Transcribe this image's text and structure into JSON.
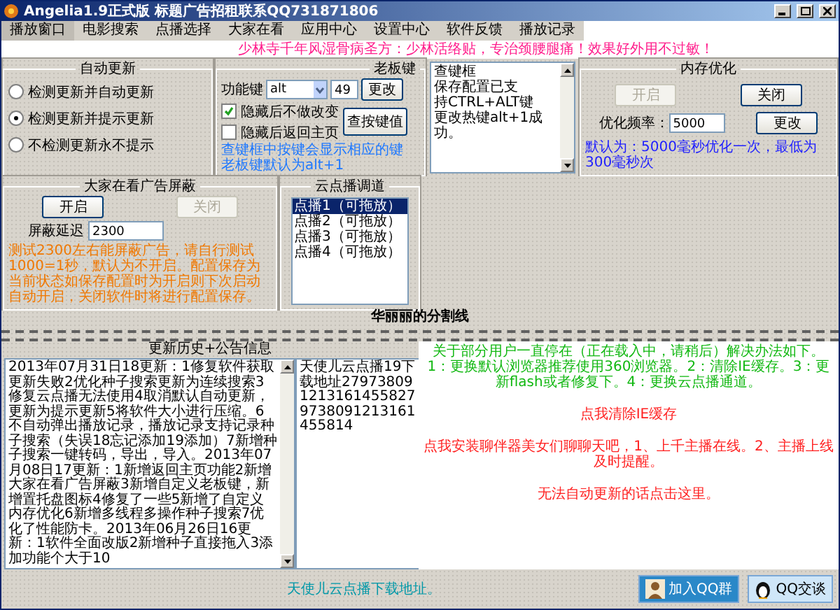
{
  "window": {
    "title": "Angelia1.9正式版   标题广告招租联系QQ731871806"
  },
  "menu": [
    {
      "label": "播放窗口",
      "selected": true
    },
    {
      "label": "电影搜索",
      "selected": false
    },
    {
      "label": "点播选择",
      "selected": false
    },
    {
      "label": "大家在看",
      "selected": false
    },
    {
      "label": "应用中心",
      "selected": false
    },
    {
      "label": "设置中心",
      "selected": false
    },
    {
      "label": "软件反馈",
      "selected": false
    },
    {
      "label": "播放记录",
      "selected": false
    }
  ],
  "banner": "少林寺千年风湿骨病圣方：少林活络贴，专治颈腰腿痛！效果好外用不过敏！",
  "auto_update": {
    "title": "自动更新",
    "options": [
      {
        "label": "检测更新并自动更新",
        "selected": false
      },
      {
        "label": "检测更新并提示更新",
        "selected": true
      },
      {
        "label": "不检测更新永不提示",
        "selected": false
      }
    ]
  },
  "boss_key": {
    "title": "老板键",
    "key_label": "功能键",
    "key_value": "alt",
    "code": "49",
    "change_button": "更改",
    "checkboxes": [
      {
        "label": "隐藏后不做改变",
        "checked": true
      },
      {
        "label": "隐藏后返回主页",
        "checked": false
      }
    ],
    "query_button": "查按键值",
    "note": [
      "查键框中按键会显示相应的键",
      "老板键默认为alt+1"
    ]
  },
  "key_log": [
    "查键框",
    "保存配置已支",
    "持CTRL+ALT键",
    "更改热键alt+1成功。"
  ],
  "memory": {
    "title": "内存优化",
    "on_button": {
      "label": "开启",
      "disabled": true
    },
    "off_button": {
      "label": "关闭",
      "disabled": false
    },
    "freq_label": "优化频率：",
    "freq_value": "5000",
    "change_button": "更改",
    "note": "默认为：5000毫秒优化一次，最低为300毫秒次"
  },
  "ad_block": {
    "title": "大家在看广告屏蔽",
    "on_button": {
      "label": "开启",
      "disabled": false
    },
    "off_button": {
      "label": "关闭",
      "disabled": true
    },
    "delay_label": "屏蔽延迟",
    "delay_value": "2300",
    "note": "测试2300左右能屏蔽广告，请自行测试1000=1秒，默认为不开启。配置保存为当前状态如保存配置时为开启则下次启动自动开启，关闭软件时将进行配置保存。"
  },
  "cloud": {
    "title": "云点播调道",
    "channels": [
      {
        "label": "点播1（可拖放）",
        "selected": true
      },
      {
        "label": "点播2（可拖放）",
        "selected": false
      },
      {
        "label": "点播3（可拖放）",
        "selected": false
      },
      {
        "label": "点播4（可拖放）",
        "selected": false
      }
    ]
  },
  "divider_label": "华丽丽的分割线",
  "history": {
    "title": "更新历史+公告信息",
    "log": "2013年07月31日18更新：1修复软件获取更新失败2优化种子搜索更新为连续搜索3修复云点播无法使用4取消默认自动更新，更新为提示更新5将软件大小进行压缩。6不自动弹出播放记录，播放记录支持记录种子搜索（失误18忘记添加19添加）7新增种子搜索一键转码，导出，导入。2013年07月08日17更新：1新增返回主页功能2新增大家在看广告屏蔽3新增自定义老板键，新增置托盘图标4修复了一些5新增了自定义内存优化6新增多线程多操作种子搜索7优化了性能防卡。2013年06月26日16更新：1软件全面改版2新增种子直接拖入3添加功能个大于10",
    "info": "天使儿云点播19下载地址2797380912131614558279738091213161455814"
  },
  "notices": {
    "solution": "关于部分用户一直停在（正在载入中，请稍后）解决办法如下。1：更换默认浏览器推荐使用360浏览器。2：清除IE缓存。3：更新flash或者修复下。4：更换云点播通道。",
    "links": [
      "点我清除IE缓存",
      "点我安装聊伴器美女们聊聊天吧，1、上千主播在线。2、主播上线及时提醒。",
      "无法自动更新的话点击这里。"
    ]
  },
  "footer": {
    "link": "天使儿云点播下载地址。",
    "buttons": [
      {
        "label": "加入QQ群",
        "kind": "group"
      },
      {
        "label": "QQ交谈",
        "kind": "chat"
      }
    ]
  }
}
